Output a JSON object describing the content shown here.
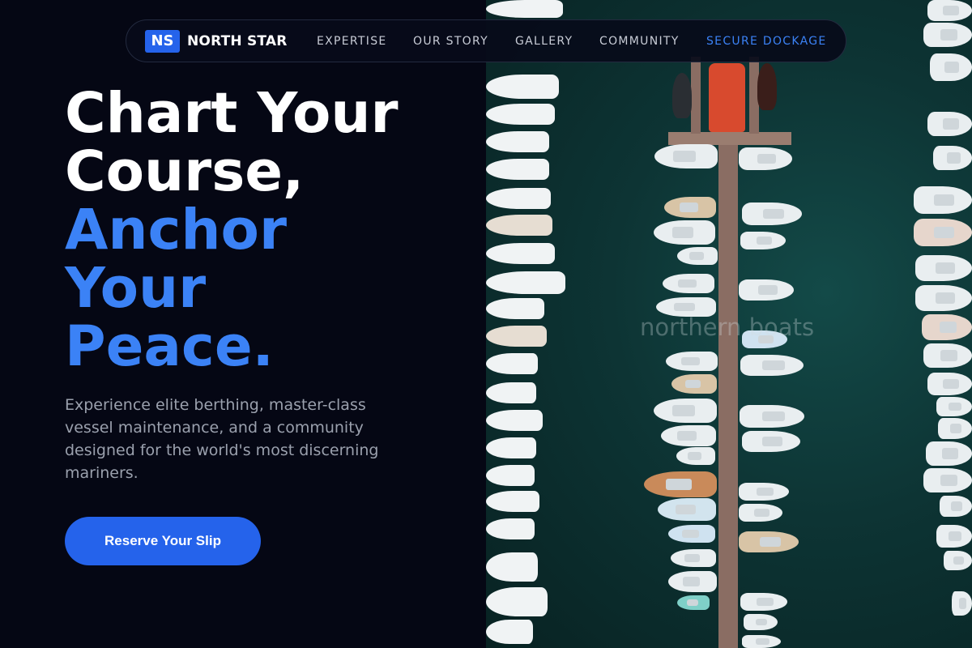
{
  "brand": {
    "badge": "NS",
    "name": "NORTH STAR"
  },
  "nav": {
    "links": [
      {
        "label": "EXPERTISE"
      },
      {
        "label": "OUR STORY"
      },
      {
        "label": "GALLERY"
      },
      {
        "label": "COMMUNITY"
      },
      {
        "label": "SECURE DOCKAGE"
      }
    ]
  },
  "hero": {
    "title_line1": "Chart Your",
    "title_line2": "Course,",
    "title_accent1": "Anchor",
    "title_accent2": "Your",
    "title_accent3": "Peace.",
    "subtitle": "Experience elite berthing, master-class vessel maintenance, and a community designed for the world's most discerning mariners.",
    "cta_label": "Reserve Your Slip"
  },
  "image": {
    "watermark": "northern boats"
  },
  "colors": {
    "accent": "#3b82f6",
    "button": "#2563eb",
    "background": "#050714"
  }
}
